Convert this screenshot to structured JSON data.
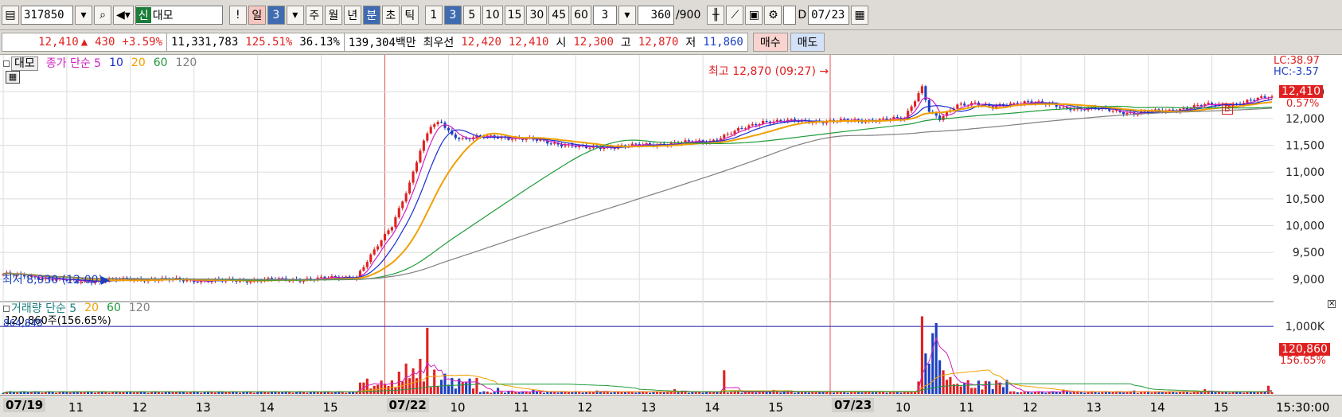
{
  "toolbar": {
    "code": "317850",
    "new_tag": "신",
    "name": "대모",
    "exclaim": "!",
    "period_day": "일",
    "period_day_n": "3",
    "week": "주",
    "month": "월",
    "year": "년",
    "minute": "분",
    "second": "초",
    "tick": "틱",
    "intervals": [
      "1",
      "3",
      "5",
      "10",
      "15",
      "30",
      "45",
      "60"
    ],
    "active_interval": "3",
    "count_select": "3",
    "count_value": "360",
    "count_total": "/900",
    "checkbox_label": "D",
    "date": "07/23"
  },
  "quote": {
    "price": "12,410",
    "arrow": "▲",
    "change": "430",
    "change_pct": "+3.59%",
    "volume": "11,331,783",
    "vol_ratio": "125.51%",
    "turnover": "36.13%",
    "amount": "139,304백만",
    "best_ask_label": "최우선",
    "best_ask": "12,420",
    "best_bid": "12,410",
    "open_label": "시",
    "open": "12,300",
    "high_label": "고",
    "high": "12,870",
    "low_label": "저",
    "low": "11,860",
    "buy_label": "매수",
    "sell_label": "매도"
  },
  "price_legend": {
    "tag": "대모",
    "ma_label": "종가 단순 5",
    "ma": [
      "10",
      "20",
      "60",
      "120"
    ]
  },
  "volume_legend": {
    "label": "거래량 단순 5",
    "ma": [
      "20",
      "60",
      "120"
    ],
    "current_volume": "120,860주(156.65%)",
    "ref_value": "864,848"
  },
  "annotations": {
    "high_marker": "최고 12,870 (09:27)",
    "low_marker": "최저 8,930 (12:00)",
    "lc": "LC:38.97",
    "hc": "HC:-3.57",
    "price_flag": "12,410",
    "price_pct": "0.57%",
    "vol_flag": "120,860",
    "vol_pct": "156.65%",
    "b_marker": "B",
    "clock": "15:30:00"
  },
  "colors": {
    "up": "#e02020",
    "down": "#1c3fbf",
    "ma5": "#d020c0",
    "ma10": "#1a2fd0",
    "ma20": "#f0a000",
    "ma60": "#1f9a3a",
    "ma120": "#808080"
  },
  "chart_data": [
    {
      "type": "candlestick",
      "title": "",
      "x_ticks": [
        "07/19",
        "11",
        "12",
        "13",
        "14",
        "15",
        "07/22",
        "10",
        "11",
        "12",
        "13",
        "14",
        "15",
        "07/23",
        "10",
        "11",
        "12",
        "13",
        "14",
        "15"
      ],
      "y_ticks": [
        9000,
        9500,
        10000,
        10500,
        11000,
        11500,
        12000,
        12500
      ],
      "ylim": [
        8700,
        12950
      ],
      "series": [
        {
          "name": "종가",
          "x": [
            0,
            20,
            40,
            60,
            80,
            90,
            100,
            110,
            115,
            118,
            121,
            124,
            127,
            130,
            135,
            140,
            150,
            165,
            180,
            200,
            215,
            220,
            225,
            230,
            235,
            240,
            245,
            250,
            255,
            260,
            262,
            265,
            270,
            275,
            280,
            290,
            300,
            310,
            320,
            330,
            340,
            350,
            358
          ],
          "values": [
            9100,
            8960,
            9000,
            8970,
            8990,
            9010,
            9050,
            10000,
            10800,
            11400,
            11850,
            11930,
            11700,
            11620,
            11650,
            11660,
            11600,
            11450,
            11500,
            11580,
            11950,
            11950,
            11950,
            11950,
            11950,
            11960,
            11970,
            11980,
            12000,
            12600,
            12150,
            11980,
            12250,
            12300,
            12200,
            12330,
            12200,
            12180,
            12100,
            12150,
            12250,
            12280,
            12410
          ]
        }
      ]
    },
    {
      "type": "bar",
      "title": "",
      "y_ticks": [
        1000000
      ],
      "ylim": [
        0,
        1250000
      ],
      "series": [
        {
          "name": "거래량",
          "x": [
            105,
            108,
            110,
            112,
            114,
            116,
            118,
            120,
            122,
            125,
            130,
            140,
            150,
            168,
            190,
            204,
            218,
            240,
            260,
            261,
            262,
            263,
            264,
            265,
            266,
            268,
            270,
            275,
            280,
            300,
            320,
            340,
            358
          ],
          "values": [
            120000,
            150000,
            200000,
            330000,
            450000,
            380000,
            520000,
            980000,
            360000,
            300000,
            180000,
            90000,
            60000,
            50000,
            70000,
            350000,
            60000,
            40000,
            1150000,
            600000,
            450000,
            900000,
            1050000,
            500000,
            350000,
            250000,
            150000,
            90000,
            70000,
            60000,
            50000,
            70000,
            120860
          ]
        }
      ]
    }
  ]
}
